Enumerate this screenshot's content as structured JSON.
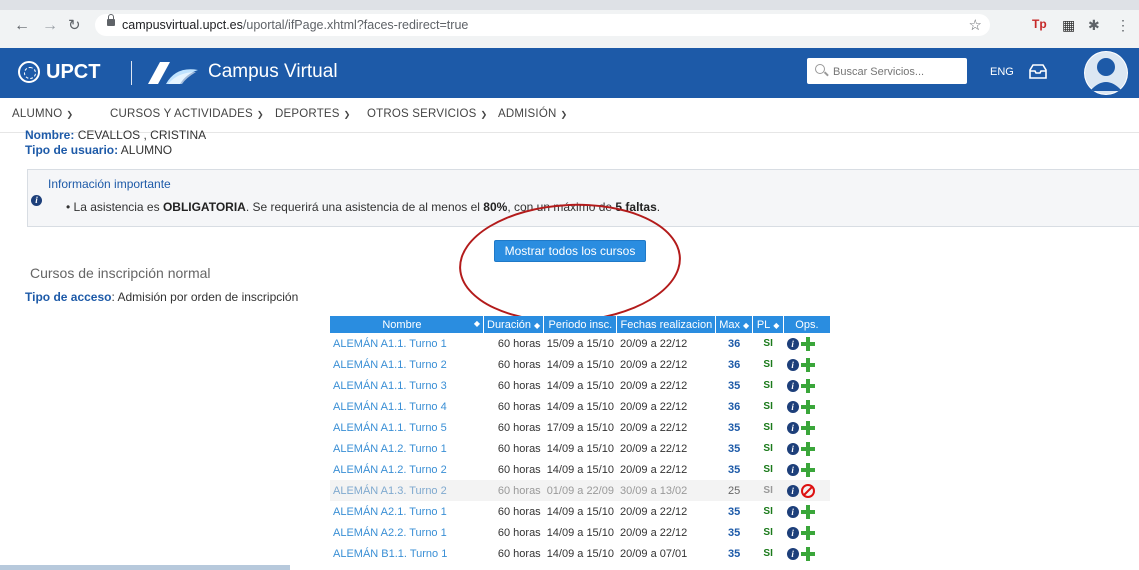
{
  "browser": {
    "url_host": "campusvirtual.upct.es",
    "url_path": "/uportal/ifPage.xhtml?faces-redirect=true"
  },
  "header": {
    "brand": "UPCT",
    "title": "Campus Virtual",
    "search_placeholder": "Buscar Servicios...",
    "lang": "ENG",
    "brand_color": "#1d5aa8"
  },
  "menu": [
    {
      "label": "ALUMNO"
    },
    {
      "label": "CURSOS Y ACTIVIDADES"
    },
    {
      "label": "DEPORTES"
    },
    {
      "label": "OTROS SERVICIOS"
    },
    {
      "label": "ADMISIÓN"
    }
  ],
  "user": {
    "name_label": "Nombre:",
    "name_value": "CEVALLOS , CRISTINA",
    "type_label": "Tipo de usuario:",
    "type_value": "ALUMNO"
  },
  "info": {
    "title": "Información importante",
    "text_1": "La asistencia es ",
    "text_bold_1": "OBLIGATORIA",
    "text_2": ". Se requerirá una asistencia de al menos el ",
    "text_bold_2": "80%",
    "text_3": ", con un máximo de ",
    "text_bold_3": "5 faltas",
    "text_4": "."
  },
  "show_all_button": "Mostrar todos los cursos",
  "section_title": "Cursos de inscripción normal",
  "access": {
    "label": "Tipo de acceso",
    "value": ": Admisión por orden de inscripción"
  },
  "table": {
    "headers": {
      "nombre": "Nombre",
      "duracion": "Duración",
      "periodo": "Periodo insc.",
      "fechas": "Fechas realizacion",
      "max": "Max",
      "pl": "PL",
      "ops": "Ops."
    },
    "rows": [
      {
        "nombre": "ALEMÁN A1.1. Turno 1",
        "duracion": "60 horas",
        "periodo": "15/09 a 15/10",
        "fechas": "20/09 a 22/12",
        "max": "36",
        "pl": "SI",
        "full": false
      },
      {
        "nombre": "ALEMÁN A1.1. Turno 2",
        "duracion": "60 horas",
        "periodo": "14/09 a 15/10",
        "fechas": "20/09 a 22/12",
        "max": "36",
        "pl": "SI",
        "full": false
      },
      {
        "nombre": "ALEMÁN A1.1. Turno 3",
        "duracion": "60 horas",
        "periodo": "14/09 a 15/10",
        "fechas": "20/09 a 22/12",
        "max": "35",
        "pl": "SI",
        "full": false
      },
      {
        "nombre": "ALEMÁN A1.1. Turno 4",
        "duracion": "60 horas",
        "periodo": "14/09 a 15/10",
        "fechas": "20/09 a 22/12",
        "max": "36",
        "pl": "SI",
        "full": false
      },
      {
        "nombre": "ALEMÁN A1.1. Turno 5",
        "duracion": "60 horas",
        "periodo": "17/09 a 15/10",
        "fechas": "20/09 a 22/12",
        "max": "35",
        "pl": "SI",
        "full": false
      },
      {
        "nombre": "ALEMÁN A1.2. Turno 1",
        "duracion": "60 horas",
        "periodo": "14/09 a 15/10",
        "fechas": "20/09 a 22/12",
        "max": "35",
        "pl": "SI",
        "full": false
      },
      {
        "nombre": "ALEMÁN A1.2. Turno 2",
        "duracion": "60 horas",
        "periodo": "14/09 a 15/10",
        "fechas": "20/09 a 22/12",
        "max": "35",
        "pl": "SI",
        "full": false
      },
      {
        "nombre": "ALEMÁN A1.3. Turno 2",
        "duracion": "60 horas",
        "periodo": "01/09 a 22/09",
        "fechas": "30/09 a 13/02",
        "max": "25",
        "pl": "SI",
        "full": true
      },
      {
        "nombre": "ALEMÁN A2.1. Turno 1",
        "duracion": "60 horas",
        "periodo": "14/09 a 15/10",
        "fechas": "20/09 a 22/12",
        "max": "35",
        "pl": "SI",
        "full": false
      },
      {
        "nombre": "ALEMÁN A2.2. Turno 1",
        "duracion": "60 horas",
        "periodo": "14/09 a 15/10",
        "fechas": "20/09 a 22/12",
        "max": "35",
        "pl": "SI",
        "full": false
      },
      {
        "nombre": "ALEMÁN B1.1. Turno 1",
        "duracion": "60 horas",
        "periodo": "14/09 a 15/10",
        "fechas": "20/09 a 07/01",
        "max": "35",
        "pl": "SI",
        "full": false
      }
    ]
  }
}
